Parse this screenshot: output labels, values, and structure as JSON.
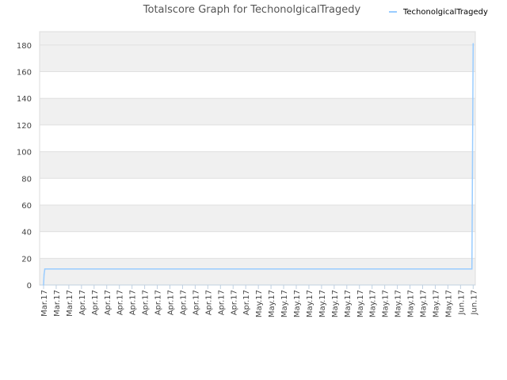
{
  "chart_data": {
    "type": "line",
    "title": "Totalscore Graph for TechonolgicalTragedy",
    "xlabel": "",
    "ylabel": "",
    "ylim": [
      0,
      190
    ],
    "yticks": [
      0,
      20,
      40,
      60,
      80,
      100,
      120,
      140,
      160,
      180
    ],
    "grid": true,
    "legend_position": "top-right",
    "x_tick_labels": [
      "Mar.17",
      "Mar.17",
      "Mar.17",
      "Apr.17",
      "Apr.17",
      "Apr.17",
      "Apr.17",
      "Apr.17",
      "Apr.17",
      "Apr.17",
      "Apr.17",
      "Apr.17",
      "Apr.17",
      "Apr.17",
      "Apr.17",
      "Apr.17",
      "Apr.17",
      "May.17",
      "May.17",
      "May.17",
      "May.17",
      "May.17",
      "May.17",
      "May.17",
      "May.17",
      "May.17",
      "May.17",
      "May.17",
      "May.17",
      "May.17",
      "May.17",
      "May.17",
      "May.17",
      "Jun.17",
      "Jun.17"
    ],
    "series": [
      {
        "name": "TechonolgicalTragedy",
        "color": "#99ccff",
        "points": [
          {
            "x": 0,
            "y": 0
          },
          {
            "x": 0.04,
            "y": 8
          },
          {
            "x": 0.1,
            "y": 12
          },
          {
            "x": 33.9,
            "y": 12
          },
          {
            "x": 34,
            "y": 181
          }
        ]
      }
    ]
  },
  "colors": {
    "band": "#f0f0f0",
    "grid": "#e0e0e0",
    "axis": "#c0d0e0"
  }
}
